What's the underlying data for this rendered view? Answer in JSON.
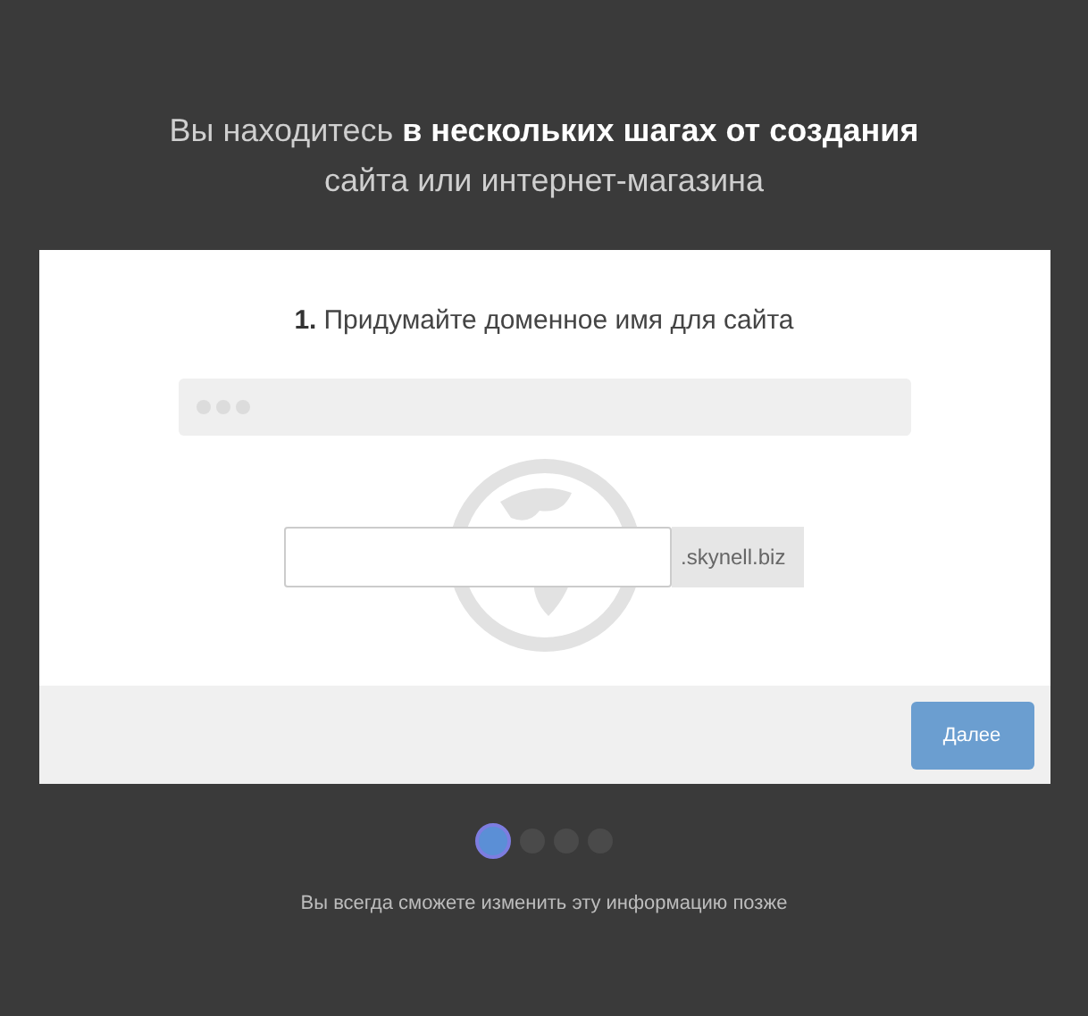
{
  "heading": {
    "text": "Вы находитесь **в нескольких шагах от создания**",
    "subtext": "сайта или интернет-магазина"
  },
  "card": {
    "step_number": "1.",
    "title": "Придумайте доменное имя для сайта",
    "domain_suffix": ".skynell.biz",
    "next_button": "Далее"
  },
  "steps": [
    {
      "selected": true
    },
    {
      "selected": false
    },
    {
      "selected": false
    },
    {
      "selected": false
    }
  ],
  "footer_note": "Вы всегда сможете изменить эту информацию позже"
}
